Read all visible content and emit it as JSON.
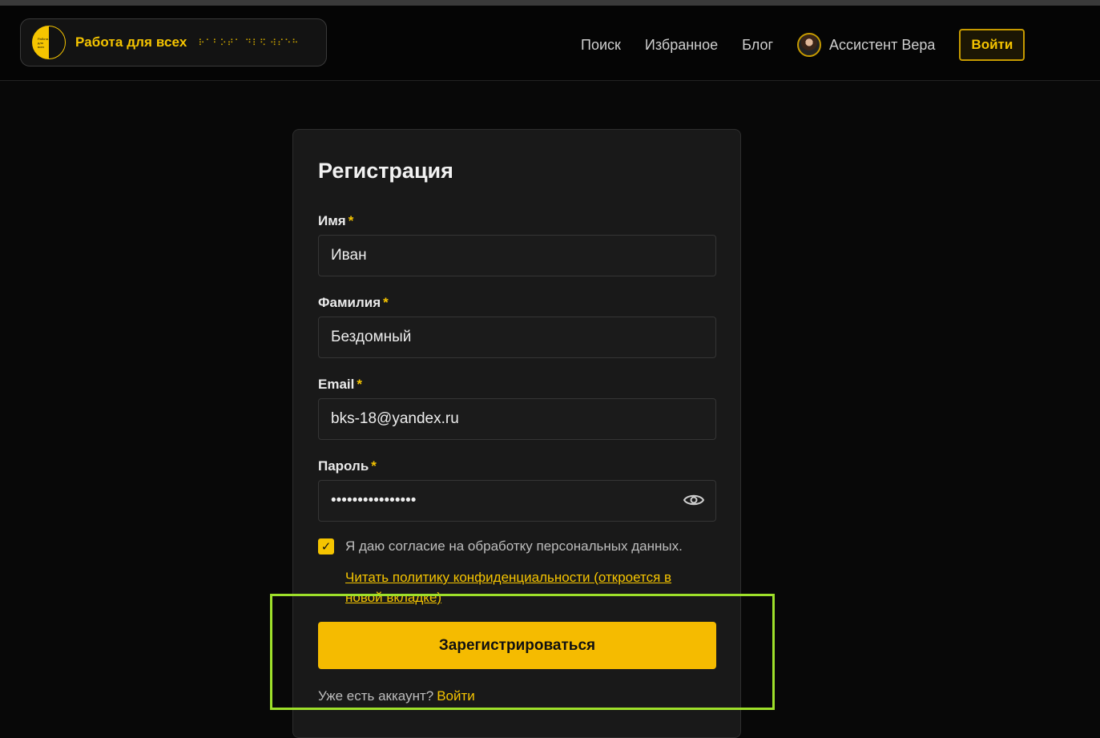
{
  "header": {
    "brand_name": "Работа для всех",
    "braille_text": "⠗⠁⠃⠕⠞⠁ ⠙⠇⠫ ⠺⠎⠑⠓",
    "logo_text": "Работа для всех",
    "nav": {
      "search": "Поиск",
      "favorites": "Избранное",
      "blog": "Блог",
      "assistant": "Ассистент Вера",
      "login": "Войти"
    }
  },
  "form": {
    "title": "Регистрация",
    "required_mark": "*",
    "first_name": {
      "label": "Имя",
      "value": "Иван"
    },
    "last_name": {
      "label": "Фамилия",
      "value": "Бездомный"
    },
    "email": {
      "label": "Email",
      "value": "bks-18@yandex.ru"
    },
    "password": {
      "label": "Пароль",
      "value": "••••••••••••••••"
    },
    "consent": {
      "checked": true,
      "text": "Я даю согласие на обработку персональных данных.",
      "policy_link": "Читать политику конфиденциальности (откроется в новой вкладке)"
    },
    "submit_label": "Зарегистрироваться",
    "have_account_text": "Уже есть аккаунт?",
    "login_link": "Войти"
  },
  "colors": {
    "accent": "#f5c400",
    "background": "#080808",
    "card": "#191919",
    "highlight": "#9ee02a"
  },
  "icons": [
    "eye-icon",
    "check-icon",
    "logo-icon",
    "assistant-avatar"
  ]
}
